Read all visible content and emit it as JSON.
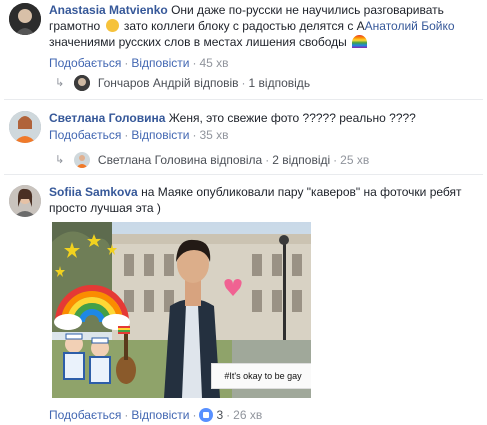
{
  "comments": [
    {
      "author": "Anastasia Matvienko",
      "text_line1": "Они даже по-русски не научились разговаривать",
      "text_line2a": "грамотно",
      "text_line2b": "зато коллеги блоку с радостью делятся с А",
      "mention": "Анатолий Бойко",
      "text_line3": "значениями русских слов в местах лишения свободы",
      "actions": {
        "like": "Подобається",
        "reply": "Відповісти",
        "time": "45 хв"
      },
      "reply_summary": {
        "name": "Гончаров Андрій",
        "verb": "відповів",
        "count": "1 відповідь"
      }
    },
    {
      "author": "Светлана Головина",
      "text": "Женя, это свежие фото ????? реально ????",
      "actions": {
        "like": "Подобається",
        "reply": "Відповісти",
        "time": "35 хв"
      },
      "reply_summary": {
        "name": "Светлана Головина",
        "verb": "відповіла",
        "count": "2 відповіді",
        "time": "25 хв"
      }
    },
    {
      "author": "Sofiia Samkova",
      "text_line1": "на Маяке опубликовали пару \"каверов\" на фоточки ребят",
      "text_line2": "просто лучшая эта )",
      "photo": {
        "sign_text": "#It's okay to be gay"
      },
      "actions": {
        "like": "Подобається",
        "reply": "Відповісти",
        "reactions": "3",
        "time": "26 хв"
      }
    }
  ],
  "separator": "·",
  "colors": {
    "link": "#4267b2",
    "author": "#365899",
    "meta": "#90949c",
    "like_blue": "#5890ff"
  },
  "icons": {
    "emoji1": "grinning-face-icon",
    "emoji2": "rainbow-icon",
    "like": "like-thumb-icon",
    "reply": "reply-arrow-icon"
  }
}
